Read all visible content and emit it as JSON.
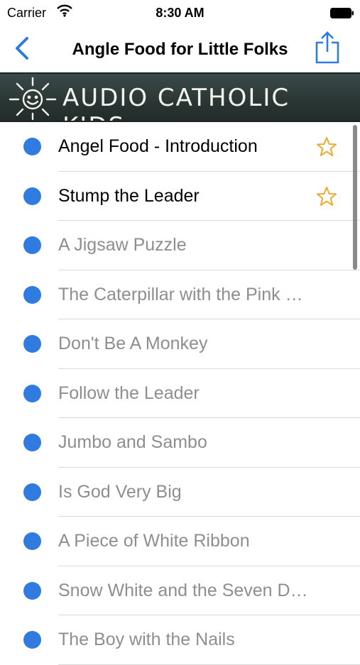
{
  "status_bar": {
    "carrier": "Carrier",
    "time": "8:30 AM"
  },
  "nav": {
    "title": "Angle Food for Little Folks",
    "back_icon": "chevron-left-icon",
    "share_icon": "share-icon",
    "accent_color": "#2f7be0"
  },
  "banner": {
    "text": "AUDIO CATHOLIC KIDS",
    "icon": "sun-icon"
  },
  "tracks": [
    {
      "title": "Angel Food - Introduction",
      "available": true,
      "favorite_icon": "star-outline-icon"
    },
    {
      "title": "Stump the Leader",
      "available": true,
      "favorite_icon": "star-outline-icon"
    },
    {
      "title": "A Jigsaw Puzzle",
      "available": false
    },
    {
      "title": "The Caterpillar with the Pink E…",
      "available": false
    },
    {
      "title": "Don't Be A Monkey",
      "available": false
    },
    {
      "title": "Follow the Leader",
      "available": false
    },
    {
      "title": "Jumbo and Sambo",
      "available": false
    },
    {
      "title": "Is God Very Big",
      "available": false
    },
    {
      "title": "A Piece of White Ribbon",
      "available": false
    },
    {
      "title": "Snow White and the Seven D…",
      "available": false
    },
    {
      "title": "The Boy with the Nails",
      "available": false
    }
  ],
  "colors": {
    "dot": "#2f7be0",
    "star": "#f0a830",
    "inactive_text": "#8e8e8e"
  }
}
